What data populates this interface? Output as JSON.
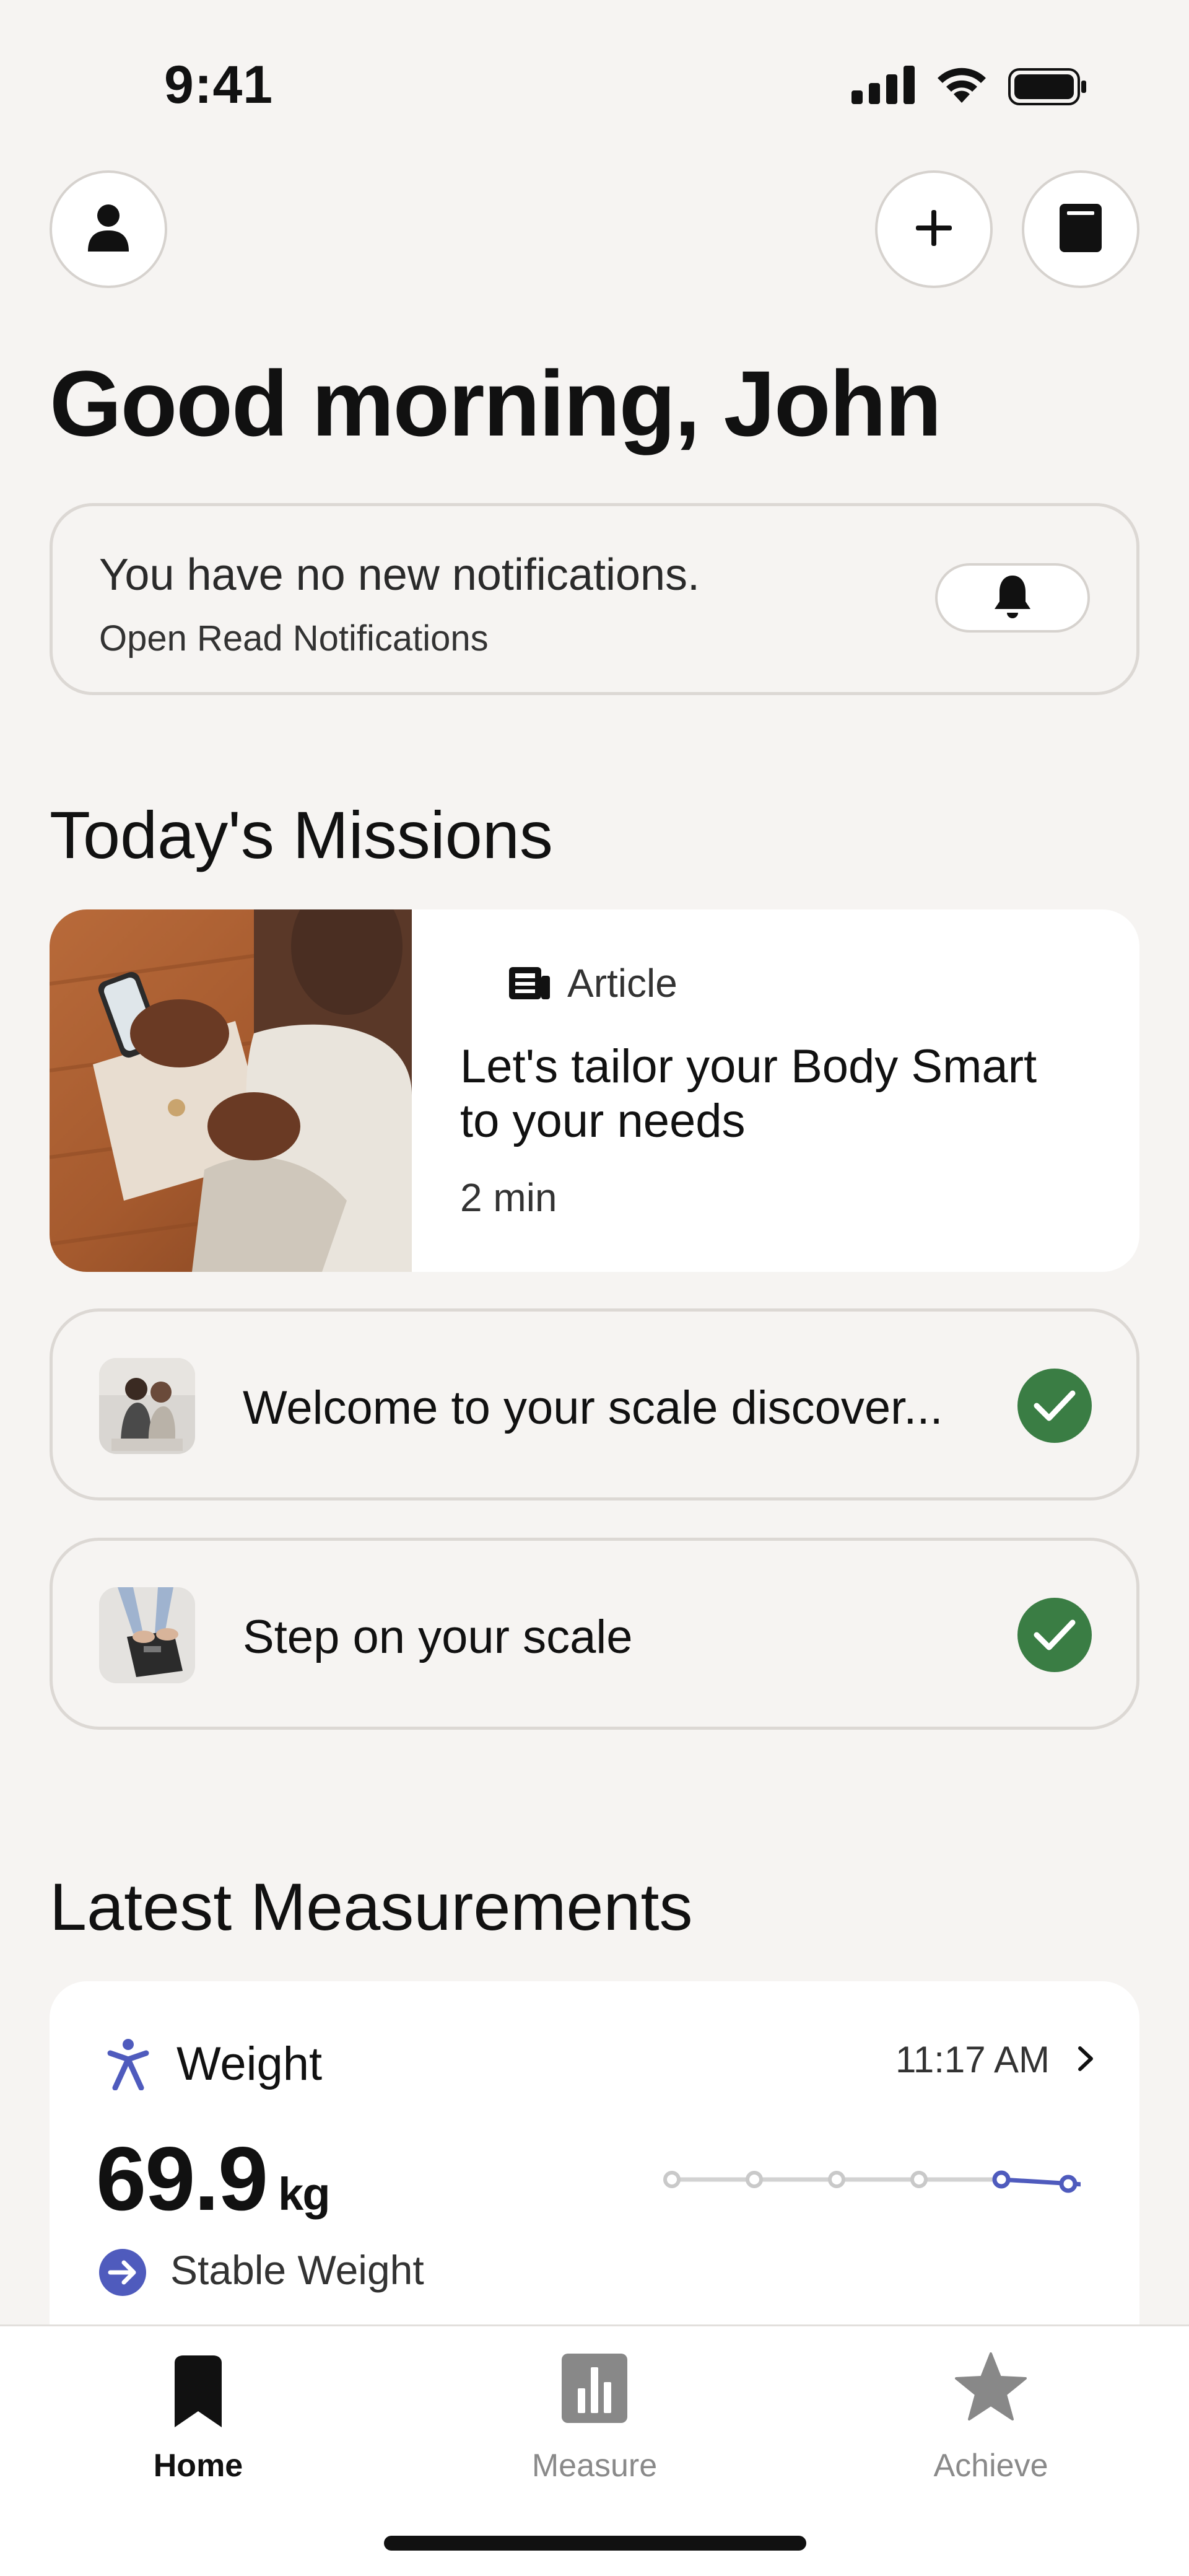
{
  "status_bar": {
    "time": "9:41"
  },
  "header": {
    "greeting": "Good morning, John"
  },
  "notifications": {
    "title": "You have no new notifications.",
    "subtitle": "Open Read Notifications"
  },
  "missions": {
    "section_title": "Today's Missions",
    "article": {
      "type": "Article",
      "title": "Let's tailor your Body Smart to your needs",
      "duration": "2 min"
    },
    "items": [
      {
        "label": "Welcome to your scale discover...",
        "completed": true
      },
      {
        "label": "Step on your scale",
        "completed": true
      }
    ]
  },
  "measurements": {
    "section_title": "Latest Measurements",
    "weight": {
      "label": "Weight",
      "time": "11:17 AM",
      "value": "69.9",
      "unit": "kg",
      "trend": "Stable Weight",
      "trend_points": 6
    }
  },
  "tabbar": {
    "tabs": [
      {
        "label": "Home",
        "active": true,
        "icon": "bookmark-icon"
      },
      {
        "label": "Measure",
        "active": false,
        "icon": "bar-chart-icon"
      },
      {
        "label": "Achieve",
        "active": false,
        "icon": "star-icon"
      }
    ]
  },
  "colors": {
    "background": "#f6f4f2",
    "accent": "#4f5bbd",
    "success": "#3a7d44",
    "text": "#111111",
    "muted": "#8a8a8a"
  }
}
